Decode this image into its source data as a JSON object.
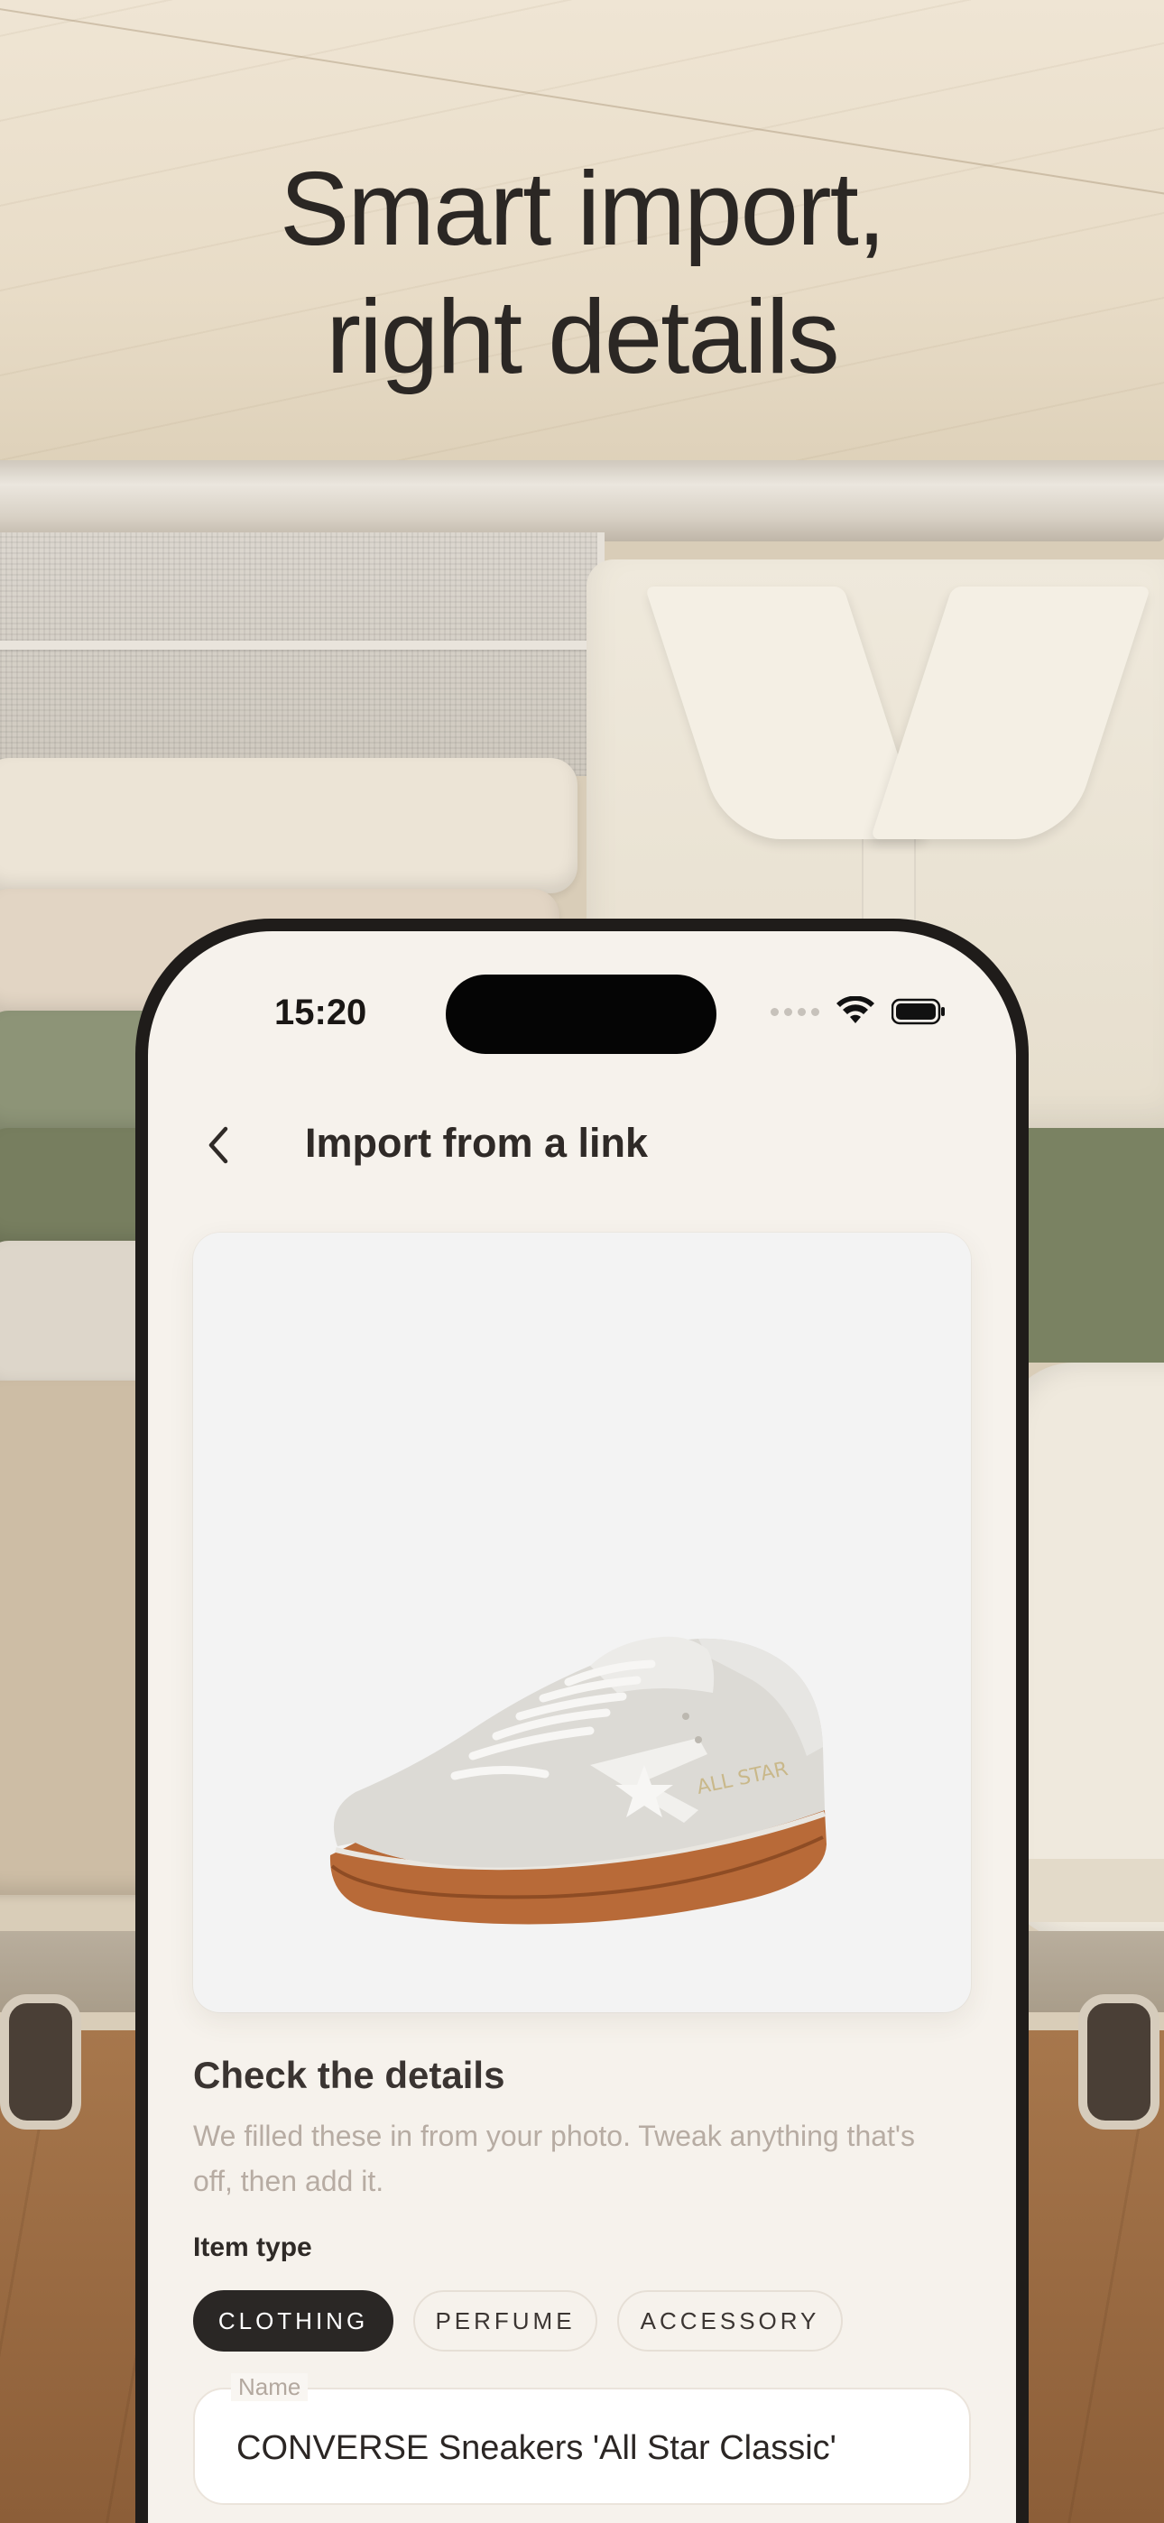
{
  "headline": {
    "line1": "Smart import,",
    "line2": "right details"
  },
  "status_bar": {
    "time": "15:20",
    "icons": [
      "signal-dots-icon",
      "wifi-icon",
      "battery-icon"
    ]
  },
  "nav": {
    "back_icon": "chevron-left-icon",
    "title": "Import from a link"
  },
  "photo": {
    "subject": "shoe-icon",
    "shoe_print": "ALL STAR"
  },
  "details": {
    "title": "Check the details",
    "subtitle": "We filled these in from your photo. Tweak anything that's off, then add it."
  },
  "item_type": {
    "label": "Item type",
    "options": [
      "CLOTHING",
      "PERFUME",
      "ACCESSORY"
    ],
    "selected": "CLOTHING"
  },
  "name_field": {
    "label": "Name",
    "value": "CONVERSE Sneakers 'All Star Classic'"
  },
  "colors": {
    "accent_dark": "#2a2725",
    "screen_bg": "#f6f2ec",
    "muted_text": "#b7aca3"
  }
}
